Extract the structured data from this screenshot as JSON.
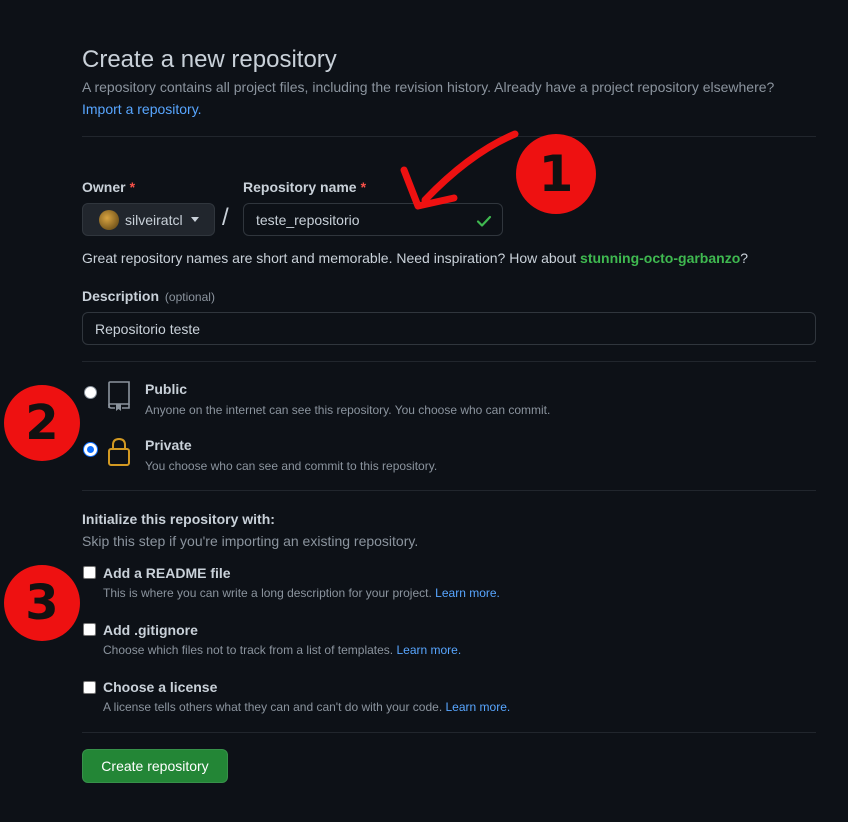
{
  "header": {
    "title": "Create a new repository",
    "subtitle": "A repository contains all project files, including the revision history. Already have a project repository elsewhere?",
    "import_link": "Import a repository."
  },
  "owner": {
    "label": "Owner",
    "required_mark": "*",
    "value": "silveiratcl"
  },
  "separator": "/",
  "repo_name": {
    "label": "Repository name",
    "required_mark": "*",
    "value": "teste_repositorio"
  },
  "name_hint": {
    "text": "Great repository names are short and memorable. Need inspiration? How about ",
    "suggestion": "stunning-octo-garbanzo",
    "suffix": "?"
  },
  "description": {
    "label": "Description",
    "optional_label": "(optional)",
    "value": "Repositorio teste"
  },
  "visibility": {
    "options": [
      {
        "title": "Public",
        "desc": "Anyone on the internet can see this repository. You choose who can commit.",
        "selected": false,
        "icon": "repo-icon"
      },
      {
        "title": "Private",
        "desc": "You choose who can see and commit to this repository.",
        "selected": true,
        "icon": "lock-icon"
      }
    ]
  },
  "initialize": {
    "title": "Initialize this repository with:",
    "subtitle": "Skip this step if you're importing an existing repository.",
    "items": [
      {
        "title": "Add a README file",
        "desc": "This is where you can write a long description for your project.",
        "link": "Learn more.",
        "checked": false
      },
      {
        "title": "Add .gitignore",
        "desc": "Choose which files not to track from a list of templates.",
        "link": "Learn more.",
        "checked": false
      },
      {
        "title": "Choose a license",
        "desc": "A license tells others what they can and can't do with your code.",
        "link": "Learn more.",
        "checked": false
      }
    ]
  },
  "submit": {
    "label": "Create repository"
  },
  "annotations": {
    "badge1": "1",
    "badge2": "2",
    "badge3": "3"
  },
  "colors": {
    "background": "#0d1117",
    "accent_link": "#58a6ff",
    "success_green": "#3fb950",
    "button_green": "#238636",
    "annotation_red": "#ee1111"
  }
}
